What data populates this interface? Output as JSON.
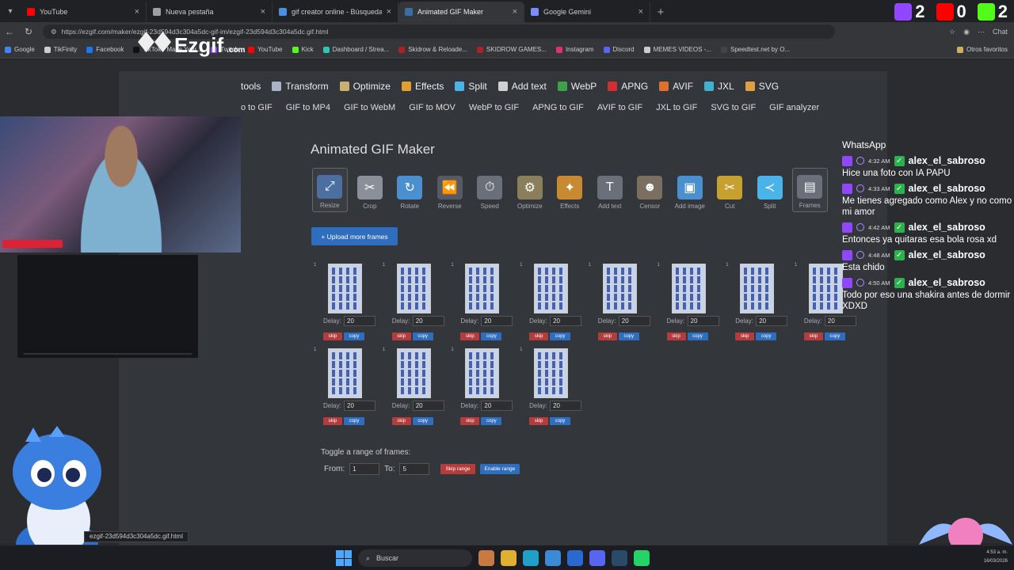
{
  "tabs": [
    {
      "title": "YouTube",
      "color": "#ff0000",
      "active": false
    },
    {
      "title": "Nueva pestaña",
      "color": "#9aa0a6",
      "active": false
    },
    {
      "title": "gif creator online - Búsqueda",
      "color": "#4a90e2",
      "active": false
    },
    {
      "title": "Animated GIF Maker",
      "color": "#3a6ea5",
      "active": true
    },
    {
      "title": "Google Gemini",
      "color": "#7b8cff",
      "active": false
    }
  ],
  "counters": [
    {
      "value": "2",
      "icon": "twitch-icon",
      "color": "#9146ff"
    },
    {
      "value": "0",
      "icon": "youtube-icon",
      "color": "#ff0000"
    },
    {
      "value": "2",
      "icon": "kick-icon",
      "color": "#53fc18"
    }
  ],
  "address": {
    "url": "https://ezgif.com/maker/ezgif-23d594d3c304a5dc-gif-im/ezgif-23d594d3c304a5dc.gif.html",
    "chat_label": "Chat"
  },
  "bookmarks": [
    {
      "label": "Google",
      "color": "#4285f4"
    },
    {
      "label": "TikFinity",
      "color": "#cccccc"
    },
    {
      "label": "Facebook",
      "color": "#1877f2"
    },
    {
      "label": "TikTok - Make Your...",
      "color": "#111111"
    },
    {
      "label": "Twitch",
      "color": "#9146ff"
    },
    {
      "label": "YouTube",
      "color": "#ff0000"
    },
    {
      "label": "Kick",
      "color": "#53fc18"
    },
    {
      "label": "Dashboard / Strea...",
      "color": "#2ec4b6"
    },
    {
      "label": "Skidrow & Reloade...",
      "color": "#aa2222"
    },
    {
      "label": "SKIDROW GAMES...",
      "color": "#aa2222"
    },
    {
      "label": "Instagram",
      "color": "#e1306c"
    },
    {
      "label": "Discord",
      "color": "#5865f2"
    },
    {
      "label": "MEMES VIDEOS -...",
      "color": "#cccccc"
    },
    {
      "label": "Speedtest.net by O...",
      "color": "#444444"
    }
  ],
  "bookmarks_other": "Otros favoritos",
  "site": {
    "logo": "Ezgif",
    "logo_suffix": ".com"
  },
  "main_nav": [
    {
      "label": "tools",
      "color": "#888888"
    },
    {
      "label": "Transform",
      "color": "#aab4c8"
    },
    {
      "label": "Optimize",
      "color": "#c8b070"
    },
    {
      "label": "Effects",
      "color": "#e0a030"
    },
    {
      "label": "Split",
      "color": "#4ab4e8"
    },
    {
      "label": "Add text",
      "color": "#d0d0d0"
    },
    {
      "label": "WebP",
      "color": "#3fa04a"
    },
    {
      "label": "APNG",
      "color": "#d03030"
    },
    {
      "label": "AVIF",
      "color": "#e07030"
    },
    {
      "label": "JXL",
      "color": "#40b0d0"
    },
    {
      "label": "SVG",
      "color": "#e0a040"
    }
  ],
  "sub_nav": [
    "o to GIF",
    "GIF to MP4",
    "GIF to WebM",
    "GIF to MOV",
    "WebP to GIF",
    "APNG to GIF",
    "AVIF to GIF",
    "JXL to GIF",
    "SVG to GIF",
    "GIF analyzer"
  ],
  "heading": "Animated GIF Maker",
  "tools": [
    {
      "label": "Resize",
      "color": "#4a6fa0",
      "selected": true,
      "glyph": "⤢"
    },
    {
      "label": "Crop",
      "color": "#8a8f99",
      "selected": false,
      "glyph": "✂"
    },
    {
      "label": "Rotate",
      "color": "#4a8fd0",
      "selected": false,
      "glyph": "↻"
    },
    {
      "label": "Reverse",
      "color": "#555a66",
      "selected": false,
      "glyph": "⏪"
    },
    {
      "label": "Speed",
      "color": "#6a6f7a",
      "selected": false,
      "glyph": "⏱"
    },
    {
      "label": "Optimize",
      "color": "#8a7f5a",
      "selected": false,
      "glyph": "⚙"
    },
    {
      "label": "Effects",
      "color": "#c88a30",
      "selected": false,
      "glyph": "✦"
    },
    {
      "label": "Add text",
      "color": "#6a6f7a",
      "selected": false,
      "glyph": "T"
    },
    {
      "label": "Censor",
      "color": "#7a6f60",
      "selected": false,
      "glyph": "☻"
    },
    {
      "label": "Add image",
      "color": "#4a90d0",
      "selected": false,
      "glyph": "▣"
    },
    {
      "label": "Cut",
      "color": "#c8a030",
      "selected": false,
      "glyph": "✂"
    },
    {
      "label": "Split",
      "color": "#4ab4e8",
      "selected": false,
      "glyph": "≺"
    },
    {
      "label": "Frames",
      "color": "#6a6f7a",
      "selected": true,
      "glyph": "▤"
    }
  ],
  "upload_button": "+ Upload more frames",
  "frame_labels": {
    "delay": "Delay:",
    "skip": "skip",
    "copy": "copy"
  },
  "frames": [
    {
      "num": "1",
      "delay": "20"
    },
    {
      "num": "1",
      "delay": "20"
    },
    {
      "num": "1",
      "delay": "20"
    },
    {
      "num": "1",
      "delay": "20"
    },
    {
      "num": "1",
      "delay": "20"
    },
    {
      "num": "1",
      "delay": "20"
    },
    {
      "num": "1",
      "delay": "20"
    },
    {
      "num": "1",
      "delay": "20"
    },
    {
      "num": "1",
      "delay": "20"
    },
    {
      "num": "1",
      "delay": "20"
    },
    {
      "num": "1",
      "delay": "20"
    },
    {
      "num": "1",
      "delay": "20"
    }
  ],
  "toggle": {
    "heading": "Toggle a range of frames:",
    "from_label": "From:",
    "from_value": "1",
    "to_label": "To:",
    "to_value": "5",
    "skip_range": "Skip range",
    "enable_range": "Enable range"
  },
  "chat": {
    "source": "WhatsApp",
    "messages": [
      {
        "time": "4:32 AM",
        "user": "alex_el_sabroso",
        "text": "Hice una foto con IA PAPU"
      },
      {
        "time": "4:33 AM",
        "user": "alex_el_sabroso",
        "text": "Me tienes agregado como Alex y no como mi amor"
      },
      {
        "time": "4:42 AM",
        "user": "alex_el_sabroso",
        "text": "Entonces ya quitaras esa bola rosa xd"
      },
      {
        "time": "4:48 AM",
        "user": "alex_el_sabroso",
        "text": "Esta chido"
      },
      {
        "time": "4:50 AM",
        "user": "alex_el_sabroso",
        "text": "Todo por eso una shakira antes de dormir XDXD"
      }
    ]
  },
  "status_url": "ezgif-23d594d3c304a5dc.gif.html",
  "taskbar": {
    "search_placeholder": "Buscar",
    "apps": [
      {
        "name": "bird-app-icon",
        "color": "#c87a40"
      },
      {
        "name": "file-explorer-icon",
        "color": "#e0b030"
      },
      {
        "name": "edge-icon",
        "color": "#1fa0c8"
      },
      {
        "name": "store-icon",
        "color": "#3a8ad8"
      },
      {
        "name": "outlook-icon",
        "color": "#2a6ad0"
      },
      {
        "name": "discord-icon",
        "color": "#5865f2"
      },
      {
        "name": "steam-icon",
        "color": "#2a4a6a"
      },
      {
        "name": "whatsapp-icon",
        "color": "#25d366"
      }
    ],
    "time": "4:53 a. m.",
    "date": "16/03/2026"
  }
}
